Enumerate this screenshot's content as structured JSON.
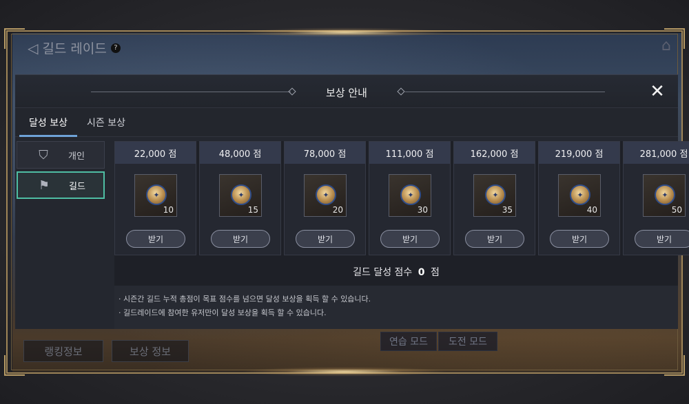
{
  "game": {
    "title": "길드 레이드",
    "help_symbol": "?",
    "bottom_tabs": [
      "랭킹정보",
      "보상 정보"
    ],
    "mode_buttons": [
      "연습 모드",
      "도전 모드"
    ]
  },
  "modal": {
    "title": "보상 안내",
    "close_symbol": "✕",
    "tabs": [
      {
        "label": "달성 보상",
        "active": true
      },
      {
        "label": "시즌 보상",
        "active": false
      }
    ],
    "sidebar": [
      {
        "label": "개인",
        "icon": "hooded-person-icon",
        "active": false
      },
      {
        "label": "길드",
        "icon": "guild-banner-icon",
        "active": true
      }
    ],
    "rewards": [
      {
        "score": "22,000 점",
        "qty": "10",
        "button": "받기"
      },
      {
        "score": "48,000 점",
        "qty": "15",
        "button": "받기"
      },
      {
        "score": "78,000 점",
        "qty": "20",
        "button": "받기"
      },
      {
        "score": "111,000 점",
        "qty": "30",
        "button": "받기"
      },
      {
        "score": "162,000 점",
        "qty": "35",
        "button": "받기"
      },
      {
        "score": "219,000 점",
        "qty": "40",
        "button": "받기"
      },
      {
        "score": "281,000 점",
        "qty": "50",
        "button": "받기"
      }
    ],
    "score_label": "길드 달성 점수",
    "score_value": "0",
    "score_unit": "점",
    "notes": [
      "· 시즌간 길드 누적 총점이 목표 점수를 넘으면 달성 보상을 획득 할 수 있습니다.",
      "· 길드레이드에 참여한 유저만이 달성 보상을 획득 할 수 있습니다."
    ]
  },
  "colors": {
    "frame_gold": "#a08658",
    "active_tab_underline": "#6fa3d8",
    "active_side_border": "#4fbfa4"
  }
}
